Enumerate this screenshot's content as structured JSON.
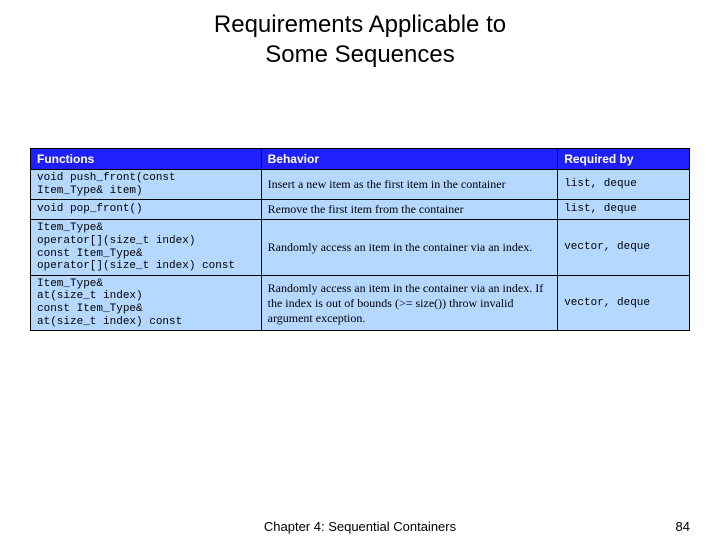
{
  "slide": {
    "title_line1": "Requirements Applicable to",
    "title_line2": "Some Sequences",
    "footer_center": "Chapter 4: Sequential Containers",
    "page_number": "84"
  },
  "table": {
    "headers": {
      "functions": "Functions",
      "behavior": "Behavior",
      "required_by": "Required by"
    },
    "rows": [
      {
        "functions": "void push_front(const\nItem_Type& item)",
        "behavior": "Insert a new item as the first item in the container",
        "required_by": "list, deque"
      },
      {
        "functions": "void pop_front()",
        "behavior": "Remove the first item from the container",
        "required_by": "list, deque"
      },
      {
        "functions": "Item_Type&\noperator[](size_t index)\nconst Item_Type&\noperator[](size_t index) const",
        "behavior": "Randomly access an item in the container via an index.",
        "required_by": "vector, deque"
      },
      {
        "functions": "Item_Type&\nat(size_t index)\nconst Item_Type&\nat(size_t index) const",
        "behavior": "Randomly access an item in the container via an index. If the index is out of bounds (>= size()) throw invalid argument exception.",
        "required_by": "vector, deque"
      }
    ]
  }
}
